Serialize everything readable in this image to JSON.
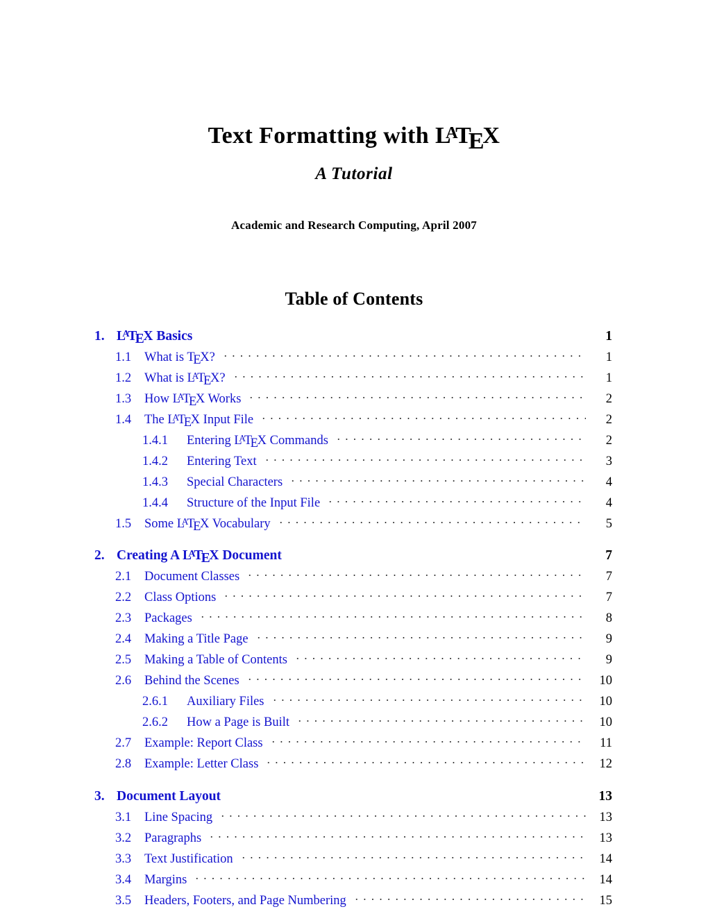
{
  "document": {
    "title_prefix": "Text Formatting with ",
    "title_logo": "LaTeX",
    "subtitle": "A Tutorial",
    "author_line": "Academic and Research Computing, April 2007",
    "toc_heading": "Table of Contents",
    "link_color": "#1414CE",
    "text_color": "#000000",
    "page_background": "#FFFFFF"
  },
  "toc": {
    "entries": [
      {
        "level": "chapter",
        "number": "1.",
        "label_prefix": "",
        "label_logo": "LaTeX",
        "label_suffix": " Basics",
        "page": "1"
      },
      {
        "level": "section",
        "number": "1.1",
        "label_prefix": "What is ",
        "label_logo": "TeX",
        "label_suffix": "?",
        "page": "1"
      },
      {
        "level": "section",
        "number": "1.2",
        "label_prefix": "What is ",
        "label_logo": "LaTeX",
        "label_suffix": "?",
        "page": "1"
      },
      {
        "level": "section",
        "number": "1.3",
        "label_prefix": "How ",
        "label_logo": "LaTeX",
        "label_suffix": " Works",
        "page": "2"
      },
      {
        "level": "section",
        "number": "1.4",
        "label_prefix": "The ",
        "label_logo": "LaTeX",
        "label_suffix": " Input File",
        "page": "2"
      },
      {
        "level": "subsection",
        "number": "1.4.1",
        "label_prefix": "Entering ",
        "label_logo": "LaTeX",
        "label_suffix": " Commands",
        "page": "2"
      },
      {
        "level": "subsection",
        "number": "1.4.2",
        "label_prefix": "Entering Text",
        "label_logo": "",
        "label_suffix": "",
        "page": "3"
      },
      {
        "level": "subsection",
        "number": "1.4.3",
        "label_prefix": "Special Characters",
        "label_logo": "",
        "label_suffix": "",
        "page": "4"
      },
      {
        "level": "subsection",
        "number": "1.4.4",
        "label_prefix": "Structure of the Input File",
        "label_logo": "",
        "label_suffix": "",
        "page": "4"
      },
      {
        "level": "section",
        "number": "1.5",
        "label_prefix": "Some ",
        "label_logo": "LaTeX",
        "label_suffix": " Vocabulary",
        "page": "5"
      },
      {
        "level": "chapter",
        "number": "2.",
        "label_prefix": "Creating A ",
        "label_logo": "LaTeX",
        "label_suffix": " Document",
        "page": "7"
      },
      {
        "level": "section",
        "number": "2.1",
        "label_prefix": "Document Classes",
        "label_logo": "",
        "label_suffix": "",
        "page": "7"
      },
      {
        "level": "section",
        "number": "2.2",
        "label_prefix": "Class Options",
        "label_logo": "",
        "label_suffix": "",
        "page": "7"
      },
      {
        "level": "section",
        "number": "2.3",
        "label_prefix": "Packages",
        "label_logo": "",
        "label_suffix": "",
        "page": "8"
      },
      {
        "level": "section",
        "number": "2.4",
        "label_prefix": "Making a Title Page",
        "label_logo": "",
        "label_suffix": "",
        "page": "9"
      },
      {
        "level": "section",
        "number": "2.5",
        "label_prefix": "Making a Table of Contents",
        "label_logo": "",
        "label_suffix": "",
        "page": "9"
      },
      {
        "level": "section",
        "number": "2.6",
        "label_prefix": "Behind the Scenes",
        "label_logo": "",
        "label_suffix": "",
        "page": "10"
      },
      {
        "level": "subsection",
        "number": "2.6.1",
        "label_prefix": "Auxiliary Files",
        "label_logo": "",
        "label_suffix": "",
        "page": "10"
      },
      {
        "level": "subsection",
        "number": "2.6.2",
        "label_prefix": "How a Page is Built",
        "label_logo": "",
        "label_suffix": "",
        "page": "10"
      },
      {
        "level": "section",
        "number": "2.7",
        "label_prefix": "Example: Report Class",
        "label_logo": "",
        "label_suffix": "",
        "page": "11"
      },
      {
        "level": "section",
        "number": "2.8",
        "label_prefix": "Example: Letter Class",
        "label_logo": "",
        "label_suffix": "",
        "page": "12"
      },
      {
        "level": "chapter",
        "number": "3.",
        "label_prefix": "Document Layout",
        "label_logo": "",
        "label_suffix": "",
        "page": "13"
      },
      {
        "level": "section",
        "number": "3.1",
        "label_prefix": "Line Spacing",
        "label_logo": "",
        "label_suffix": "",
        "page": "13"
      },
      {
        "level": "section",
        "number": "3.2",
        "label_prefix": "Paragraphs",
        "label_logo": "",
        "label_suffix": "",
        "page": "13"
      },
      {
        "level": "section",
        "number": "3.3",
        "label_prefix": "Text Justification",
        "label_logo": "",
        "label_suffix": "",
        "page": "14"
      },
      {
        "level": "section",
        "number": "3.4",
        "label_prefix": "Margins",
        "label_logo": "",
        "label_suffix": "",
        "page": "14"
      },
      {
        "level": "section",
        "number": "3.5",
        "label_prefix": "Headers, Footers, and Page Numbering",
        "label_logo": "",
        "label_suffix": "",
        "page": "15"
      }
    ]
  }
}
